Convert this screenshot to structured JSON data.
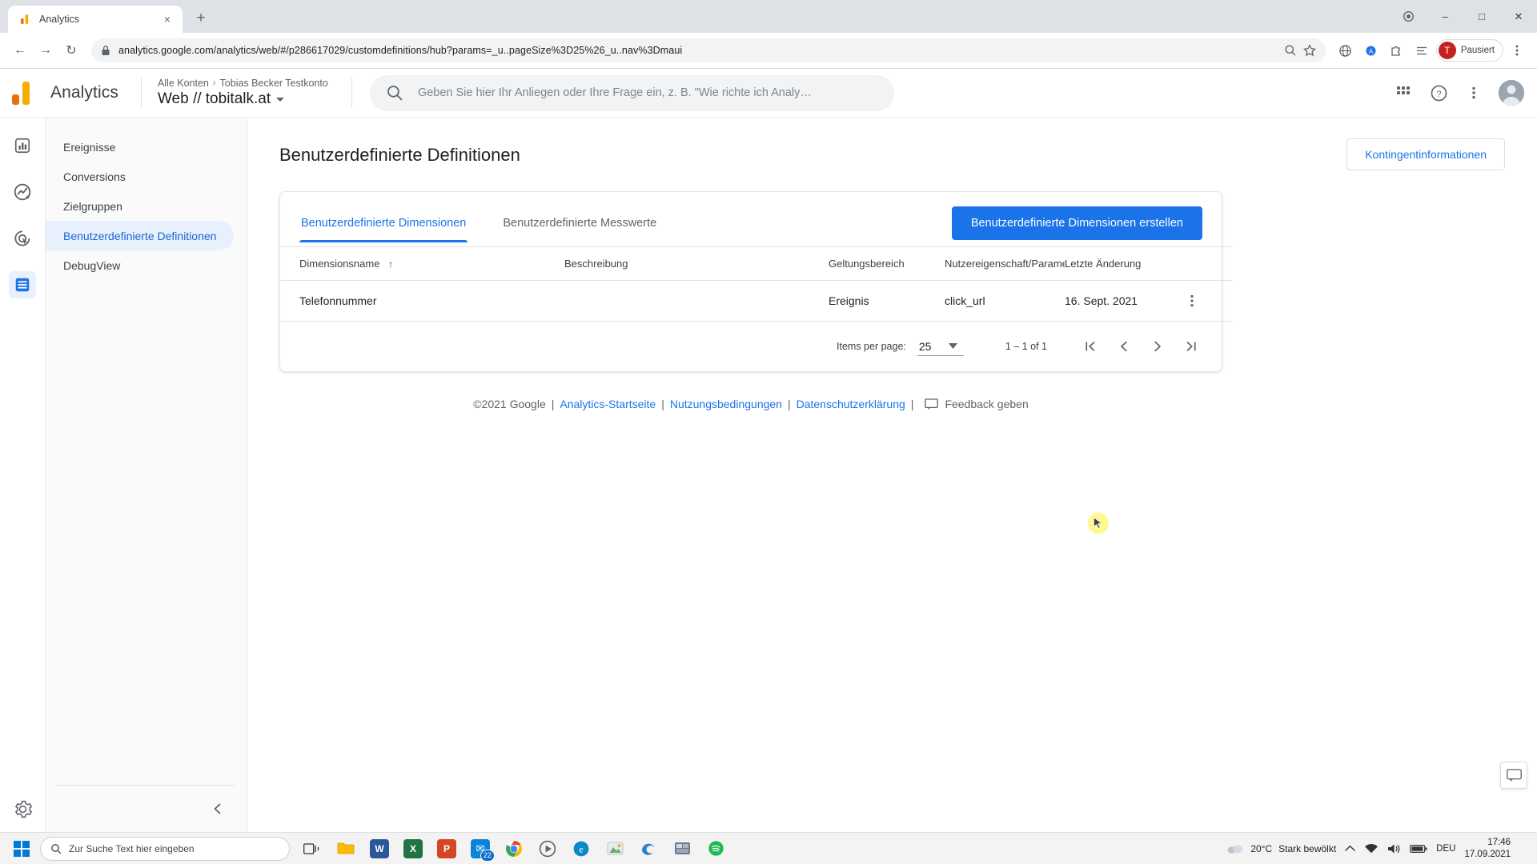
{
  "browser": {
    "tab": {
      "title": "Analytics",
      "favicon": "analytics-bars-icon",
      "close_label": "×"
    },
    "new_tab_label": "+",
    "window_controls": {
      "minimize": "–",
      "maximize": "□",
      "close": "✕"
    },
    "nav": {
      "back": "←",
      "forward": "→",
      "reload": "↻"
    },
    "omnibox": {
      "url": "analytics.google.com/analytics/web/#/p286617029/customdefinitions/hub?params=_u..pageSize%3D25%26_u..nav%3Dmaui",
      "lock_icon": "lock-icon"
    },
    "profile": {
      "initial": "T",
      "label": "Pausiert",
      "color": "#c5221f"
    }
  },
  "ga_header": {
    "wordmark": "Analytics",
    "breadcrumb": {
      "account": "Alle Konten",
      "separator": "›",
      "property": "Tobias Becker Testkonto"
    },
    "property_title": "Web // tobitalk.at",
    "search_placeholder": "Geben Sie hier Ihr Anliegen oder Ihre Frage ein, z. B. \"Wie richte ich Analy…",
    "icons": [
      "apps-grid-icon",
      "help-circle-icon",
      "more-vert-icon",
      "account-avatar"
    ]
  },
  "rail": {
    "items": [
      {
        "name": "reports-icon",
        "active": false
      },
      {
        "name": "explore-icon",
        "active": false
      },
      {
        "name": "advertising-icon",
        "active": false
      },
      {
        "name": "configure-icon",
        "active": true
      }
    ],
    "settings_icon": "gear-icon"
  },
  "subnav": {
    "items": [
      {
        "label": "Ereignisse",
        "active": false
      },
      {
        "label": "Conversions",
        "active": false
      },
      {
        "label": "Zielgruppen",
        "active": false
      },
      {
        "label": "Benutzerdefinierte Definitionen",
        "active": true
      },
      {
        "label": "DebugView",
        "active": false
      }
    ],
    "collapse_icon": "chevron-left-icon"
  },
  "content": {
    "page_title": "Benutzerdefinierte Definitionen",
    "quota_button": "Kontingentinformationen",
    "tabs": [
      {
        "label": "Benutzerdefinierte Dimensionen",
        "active": true
      },
      {
        "label": "Benutzerdefinierte Messwerte",
        "active": false
      }
    ],
    "create_button": "Benutzerdefinierte Dimensionen erstellen",
    "table": {
      "columns": [
        "Dimensionsname",
        "Beschreibung",
        "Geltungsbereich",
        "Nutzereigenschaft/Parameter",
        "Letzte Änderung"
      ],
      "sort_column": "Dimensionsname",
      "sort_arrow": "↑",
      "rows": [
        {
          "name": "Telefonnummer",
          "description": "",
          "scope": "Ereignis",
          "parameter": "click_url",
          "modified": "16. Sept. 2021",
          "menu_icon": "kebab-menu-icon"
        }
      ]
    },
    "pagination": {
      "items_per_page_label": "Items per page:",
      "items_per_page_value": "25",
      "range": "1 – 1 of 1",
      "first_icon": "first-page-icon",
      "prev_icon": "prev-page-icon",
      "next_icon": "next-page-icon",
      "last_icon": "last-page-icon"
    },
    "footer": {
      "copyright": "©2021 Google",
      "links": [
        "Analytics-Startseite",
        "Nutzungsbedingungen",
        "Datenschutzerklärung"
      ],
      "separator": "|",
      "feedback_label": "Feedback geben"
    }
  },
  "taskbar": {
    "start_label": "start-icon",
    "search_placeholder": "Zur Suche Text hier eingeben",
    "task_view": "task-view-icon",
    "apps": [
      {
        "name": "file-explorer",
        "glyph": "🗀",
        "color": "#ffb900"
      },
      {
        "name": "word",
        "glyph": "W",
        "color": "#2b579a"
      },
      {
        "name": "excel",
        "glyph": "X",
        "color": "#217346"
      },
      {
        "name": "powerpoint",
        "glyph": "P",
        "color": "#d24726"
      },
      {
        "name": "mail",
        "glyph": "✉",
        "color": "#0078d4",
        "badge": "22"
      },
      {
        "name": "chrome",
        "glyph": "",
        "color": "#4285f4",
        "active": true
      },
      {
        "name": "media-player",
        "glyph": "●",
        "color": "#7a5fa0"
      },
      {
        "name": "edge-legacy",
        "glyph": "e",
        "color": "#0b88c7"
      },
      {
        "name": "photos",
        "glyph": "▣",
        "color": "#e06c25"
      },
      {
        "name": "edge",
        "glyph": "",
        "color": "#2f80c9"
      },
      {
        "name": "gallery",
        "glyph": "▤",
        "color": "#5a6e88"
      },
      {
        "name": "spotify",
        "glyph": "♪",
        "color": "#1db954"
      }
    ],
    "tray": {
      "weather_temp": "20°C",
      "weather_desc": "Stark bewölkt",
      "chevron": "∧",
      "network_icon": "wifi-icon",
      "volume_icon": "speaker-icon",
      "battery_icon": "battery-icon",
      "language": "DEU",
      "time": "17:46",
      "date": "17.09.2021"
    }
  }
}
